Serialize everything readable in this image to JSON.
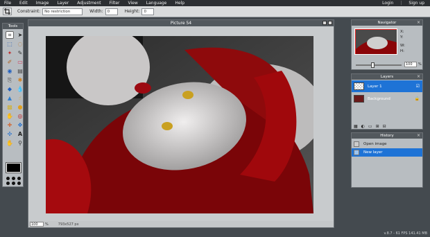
{
  "menubar": {
    "items": [
      "File",
      "Edit",
      "Image",
      "Layer",
      "Adjustment",
      "Filter",
      "View",
      "Language",
      "Help"
    ],
    "login": "Login",
    "signup": "Sign up"
  },
  "options": {
    "constraint_label": "Constraint:",
    "constraint_value": "No restriction",
    "width_label": "Width:",
    "width_value": "0",
    "height_label": "Height:",
    "height_value": "0"
  },
  "tools": {
    "title": "Tools",
    "items": [
      "crop-icon",
      "move-icon",
      "marquee-icon",
      "lasso-icon",
      "wand-icon",
      "pencil-icon",
      "brush-icon",
      "eraser-icon",
      "bucket-icon",
      "gradient-icon",
      "clone-icon",
      "color-replace-icon",
      "drawing-icon",
      "blur-icon",
      "sharpen-icon",
      "smudge-icon",
      "sponge-icon",
      "dodge-icon",
      "burn-icon",
      "red-eye-icon",
      "spot-heal-icon",
      "bloat-icon",
      "pinch-icon",
      "text-icon",
      "hand-icon",
      "zoom-icon"
    ],
    "primary_color": "#000000"
  },
  "image_window": {
    "title": "Picture 54",
    "zoom": "100",
    "zoom_unit": "%",
    "dimensions": "793x527 px"
  },
  "navigator": {
    "title": "Navigator",
    "x_label": "X:",
    "y_label": "Y:",
    "w_label": "W:",
    "h_label": "H:",
    "zoom": "100",
    "zoom_unit": "%"
  },
  "layers": {
    "title": "Layers",
    "items": [
      {
        "label": "Layer 1",
        "selected": true
      },
      {
        "label": "Background",
        "selected": false
      }
    ]
  },
  "history": {
    "title": "History",
    "items": [
      {
        "label": "Open image",
        "selected": false
      },
      {
        "label": "New layer",
        "selected": true
      }
    ]
  },
  "footer": {
    "version": "v.8.7 - 61 FPS 141.41 MB"
  },
  "colors": {
    "accent": "#1e73d6",
    "panel_header": "#52585d",
    "background": "#444a4f"
  }
}
